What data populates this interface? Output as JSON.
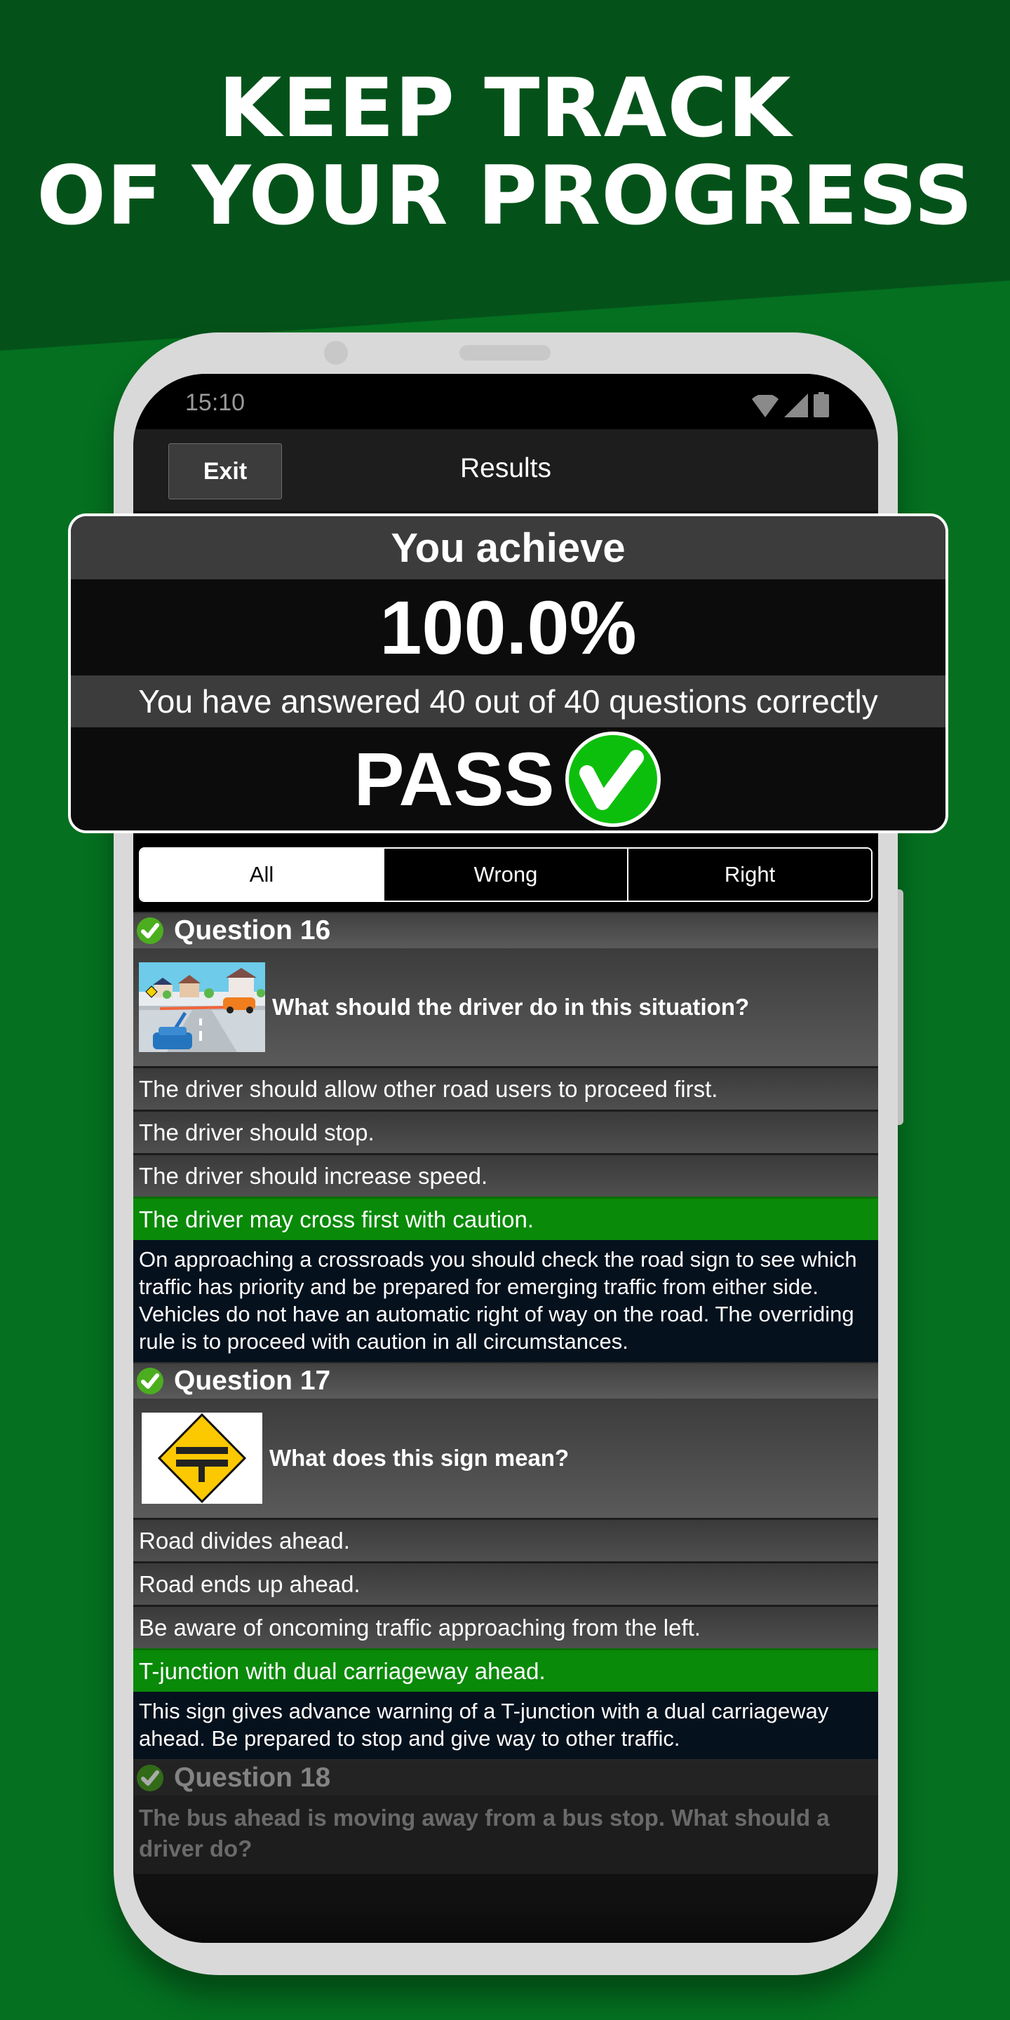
{
  "promo": {
    "headline_line1": "KEEP TRACK",
    "headline_line2": "OF YOUR PROGRESS",
    "colors": {
      "bg_dark_green": "#04521a",
      "bg_green": "#047020"
    }
  },
  "status_bar": {
    "time": "15:10",
    "icons": [
      "wifi-icon",
      "cellular-signal-icon",
      "battery-icon"
    ]
  },
  "nav": {
    "exit_label": "Exit",
    "title": "Results"
  },
  "result": {
    "heading": "You achieve",
    "score": "100.0%",
    "summary": "You have answered 40 out of 40 questions correctly",
    "verdict": "PASS",
    "verdict_icon": "check-circle-icon",
    "correct": 40,
    "total": 40
  },
  "filter_tabs": [
    {
      "label": "All",
      "active": true
    },
    {
      "label": "Wrong",
      "active": false
    },
    {
      "label": "Right",
      "active": false
    }
  ],
  "questions": [
    {
      "title": "Question 16",
      "status": "correct",
      "image": "road-crossroads-illustration",
      "text": "What should the driver do in this situation?",
      "answers": [
        {
          "text": "The driver should allow other road users to proceed first.",
          "correct": false
        },
        {
          "text": "The driver should stop.",
          "correct": false
        },
        {
          "text": "The driver should increase speed.",
          "correct": false
        },
        {
          "text": "The driver may cross first with caution.",
          "correct": true
        }
      ],
      "explanation": "On approaching a crossroads you should check the road sign to see which traffic has priority and be prepared for emerging traffic from either side. Vehicles do not have an automatic right of way on the road. The overriding rule is to proceed with caution in all circumstances."
    },
    {
      "title": "Question 17",
      "status": "correct",
      "image": "t-junction-dual-carriageway-sign",
      "text": "What does this sign mean?",
      "answers": [
        {
          "text": "Road divides ahead.",
          "correct": false
        },
        {
          "text": "Road ends up ahead.",
          "correct": false
        },
        {
          "text": "Be aware of oncoming traffic approaching from the left.",
          "correct": false
        },
        {
          "text": "T-junction with dual carriageway ahead.",
          "correct": true
        }
      ],
      "explanation": "This sign gives advance warning of a T-junction with a dual carriageway ahead. Be prepared to stop and give way to other traffic."
    },
    {
      "title": "Question 18",
      "status": "correct",
      "text": "The bus ahead is moving away from a bus stop. What should a driver do?"
    }
  ],
  "colors": {
    "correct_answer_bg": "#0a8a09",
    "explanation_bg": "#05111d",
    "check_green": "#0dbf0d"
  }
}
